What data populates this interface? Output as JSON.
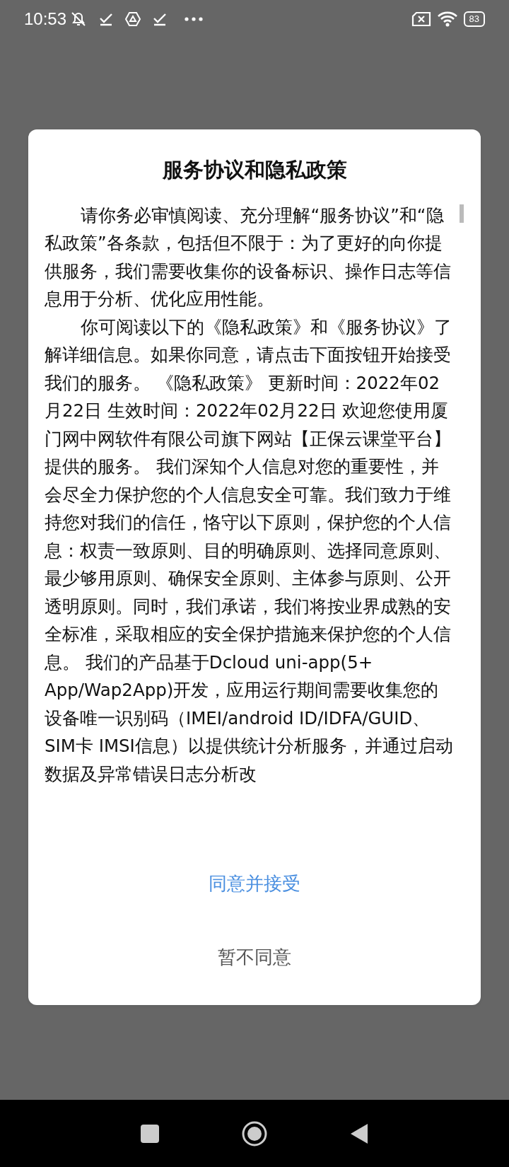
{
  "status_bar": {
    "time": "10:53",
    "battery": "83"
  },
  "dialog": {
    "title": "服务协议和隐私政策",
    "paragraphs": [
      "请你务必审慎阅读、充分理解“服务协议”和“隐私政策”各条款，包括但不限于：为了更好的向你提供服务，我们需要收集你的设备标识、操作日志等信息用于分析、优化应用性能。",
      "你可阅读以下的《隐私政策》和《服务协议》了解详细信息。如果你同意，请点击下面按钮开始接受我们的服务。 《隐私政策》 更新时间：2022年02月22日 生效时间：2022年02月22日 欢迎您使用厦门网中网软件有限公司旗下网站【正保云课堂平台】提供的服务。 我们深知个人信息对您的重要性，并会尽全力保护您的个人信息安全可靠。我们致力于维持您对我们的信任，恪守以下原则，保护您的个人信息：权责一致原则、目的明确原则、选择同意原则、最少够用原则、确保安全原则、主体参与原则、公开透明原则。同时，我们承诺，我们将按业界成熟的安全标准，采取相应的安全保护措施来保护您的个人信息。 我们的产品基于Dcloud uni-app(5+ App/Wap2App)开发，应用运行期间需要收集您的设备唯一识别码（IMEI/android ID/IDFA/GUID、SIM卡 IMSI信息）以提供统计分析服务，并通过启动数据及异常错误日志分析改"
    ],
    "buttons": [
      {
        "label": "同意并接受",
        "kind": "primary"
      },
      {
        "label": "暂不同意",
        "kind": "secondary"
      }
    ]
  }
}
